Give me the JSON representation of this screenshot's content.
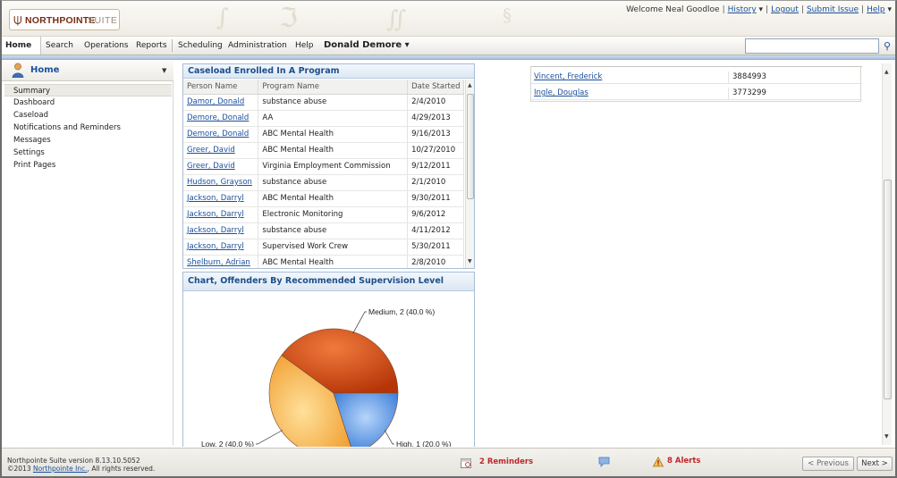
{
  "app": {
    "brand": "NORTHPOINTE",
    "suite": "SUITE"
  },
  "userbar": {
    "welcome": "Welcome Neal Goodloe",
    "history": "History",
    "logout": "Logout",
    "submit_issue": "Submit Issue",
    "help": "Help"
  },
  "nav": {
    "items": [
      "Home",
      "Search",
      "Operations",
      "Reports",
      "Scheduling",
      "Administration",
      "Help"
    ],
    "person": "Donald Demore",
    "search_value": ""
  },
  "sidebar": {
    "title": "Home",
    "items": [
      "Summary",
      "Dashboard",
      "Caseload",
      "Notifications and Reminders",
      "Messages",
      "Settings",
      "Print Pages"
    ],
    "selected": "Summary"
  },
  "caseload": {
    "title": "Caseload Enrolled In A Program",
    "columns": [
      "Person Name",
      "Program Name",
      "Date Started"
    ],
    "rows": [
      [
        "Damor, Donald",
        "substance abuse",
        "2/4/2010"
      ],
      [
        "Demore, Donald",
        "AA",
        "4/29/2013"
      ],
      [
        "Demore, Donald",
        "ABC Mental Health",
        "9/16/2013"
      ],
      [
        "Greer, David",
        "ABC Mental Health",
        "10/27/2010"
      ],
      [
        "Greer, David",
        "Virginia Employment Commission",
        "9/12/2011"
      ],
      [
        "Hudson, Grayson",
        "substance abuse",
        "2/1/2010"
      ],
      [
        "Jackson, Darryl",
        "ABC Mental Health",
        "9/30/2011"
      ],
      [
        "Jackson, Darryl",
        "Electronic Monitoring",
        "9/6/2012"
      ],
      [
        "Jackson, Darryl",
        "substance abuse",
        "4/11/2012"
      ],
      [
        "Jackson, Darryl",
        "Supervised Work Crew",
        "5/30/2011"
      ],
      [
        "Shelburn, Adrian",
        "ABC Mental Health",
        "2/8/2010"
      ]
    ]
  },
  "chart_panel": {
    "title": "Chart, Offenders By Recommended Supervision Level"
  },
  "chart_data": {
    "type": "pie",
    "categories": [
      "Medium",
      "Low",
      "High"
    ],
    "values": [
      2,
      2,
      1
    ],
    "labels": [
      "Medium, 2 (40.0 %)",
      "Low, 2 (40.0 %)",
      "High, 1 (20.0 %)"
    ],
    "colors": [
      "#d8481a",
      "#f6a93c",
      "#4d8fe0"
    ]
  },
  "right_list": {
    "rows": [
      {
        "name": "Vincent, Frederick",
        "number": "3884993"
      },
      {
        "name": "Ingle, Douglas",
        "number": "3773299"
      }
    ]
  },
  "footer": {
    "version": "Northpointe Suite version 8.13.10.5052",
    "copyright_prefix": "©2013",
    "copyright_link": "Northpointe Inc.",
    "copyright_suffix": ", All rights reserved.",
    "reminders": "2 Reminders",
    "alerts": "8 Alerts",
    "previous": "< Previous",
    "next": "Next >"
  }
}
